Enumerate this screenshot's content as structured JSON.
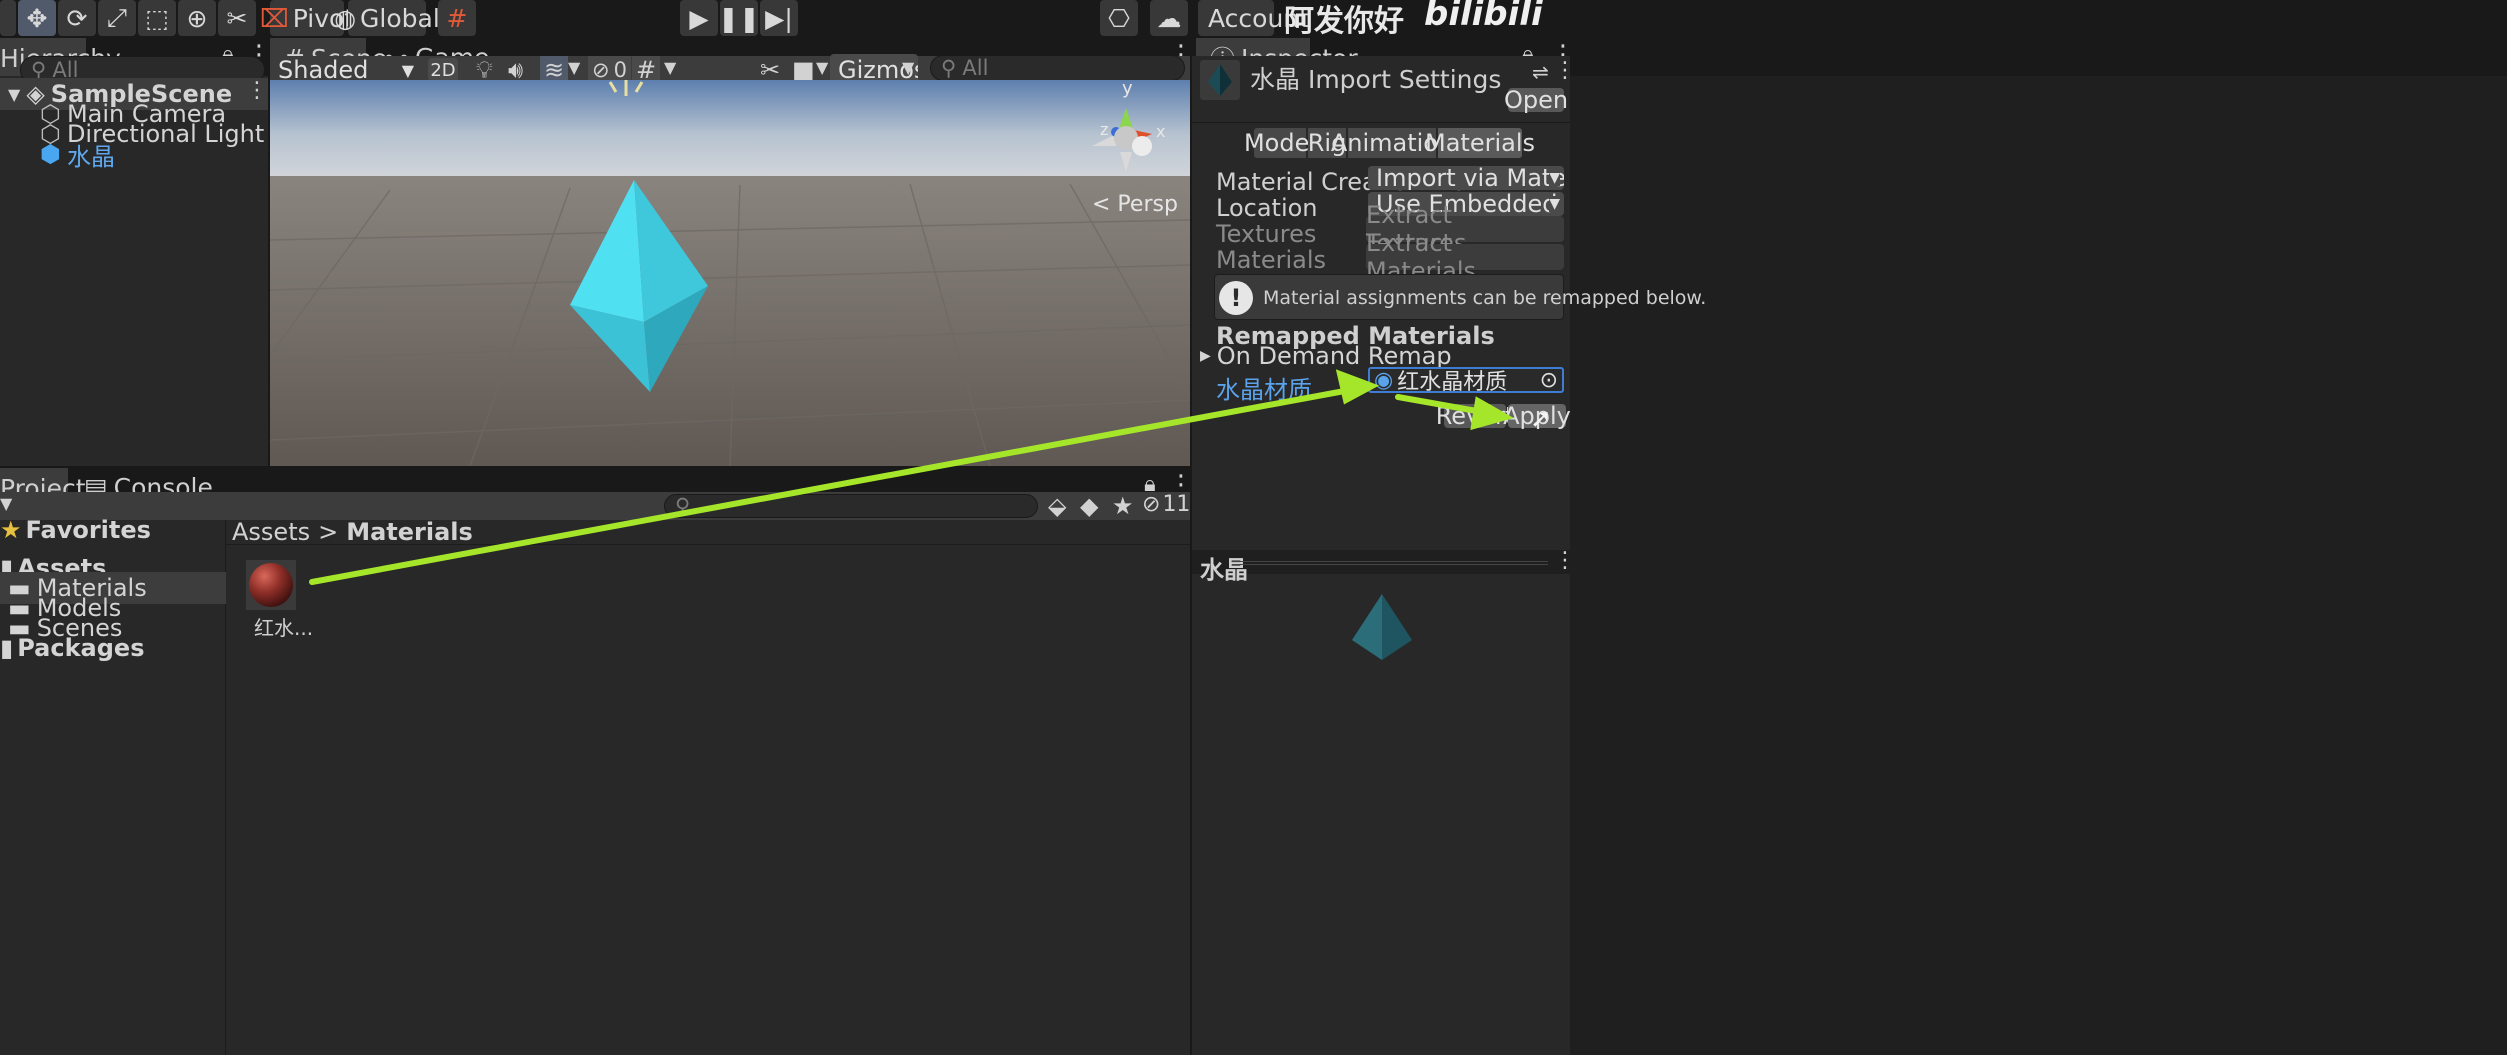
{
  "toolbar": {
    "pivot": "Pivot",
    "global": "Global",
    "account": "Account",
    "watermark_text": "阿发你好",
    "watermark_logo": "bilibili"
  },
  "hierarchy": {
    "tab": "Hierarchy",
    "search_placeholder": "All",
    "scene": "SampleScene",
    "items": [
      "Main Camera",
      "Directional Light",
      "水晶"
    ]
  },
  "scene_view": {
    "tabs": [
      "Scene",
      "Game"
    ],
    "shading": "Shaded",
    "mode_2d": "2D",
    "hidden_count": "0",
    "gizmos": "Gizmos",
    "search_placeholder": "All",
    "persp": "< Persp",
    "axis_y": "y",
    "axis_x": "x",
    "axis_z": "z"
  },
  "inspector": {
    "tab": "Inspector",
    "title": "水晶 Import Settings",
    "open": "Open",
    "tabs": [
      "Model",
      "Rig",
      "Animation",
      "Materials"
    ],
    "fields": {
      "material_creation_label": "Material Creation Mc",
      "material_creation_value": "Import via MaterialDescri",
      "location_label": "Location",
      "location_value": "Use Embedded Materials",
      "textures_label": "Textures",
      "extract_textures": "Extract Textures...",
      "materials_label": "Materials",
      "extract_materials": "Extract Materials..."
    },
    "info_text": "Material assignments can be remapped below.",
    "remapped_header": "Remapped Materials",
    "on_demand": "On Demand Remap",
    "remap_key": "水晶材质",
    "remap_value": "红水晶材质",
    "revert": "Revert",
    "apply": "Apply",
    "preview_title": "水晶"
  },
  "project": {
    "tabs": [
      "Project",
      "Console"
    ],
    "hidden_count": "11",
    "favorites": "Favorites",
    "assets": "Assets",
    "folders": [
      "Materials",
      "Models",
      "Scenes"
    ],
    "packages": "Packages",
    "breadcrumb_root": "Assets",
    "breadcrumb_sep": ">",
    "breadcrumb_current": "Materials",
    "asset_label": "红水..."
  },
  "colors": {
    "accent_blue": "#4c8fd6",
    "arrow_green": "#a5e52a",
    "crystal": "#4fe0f2"
  }
}
